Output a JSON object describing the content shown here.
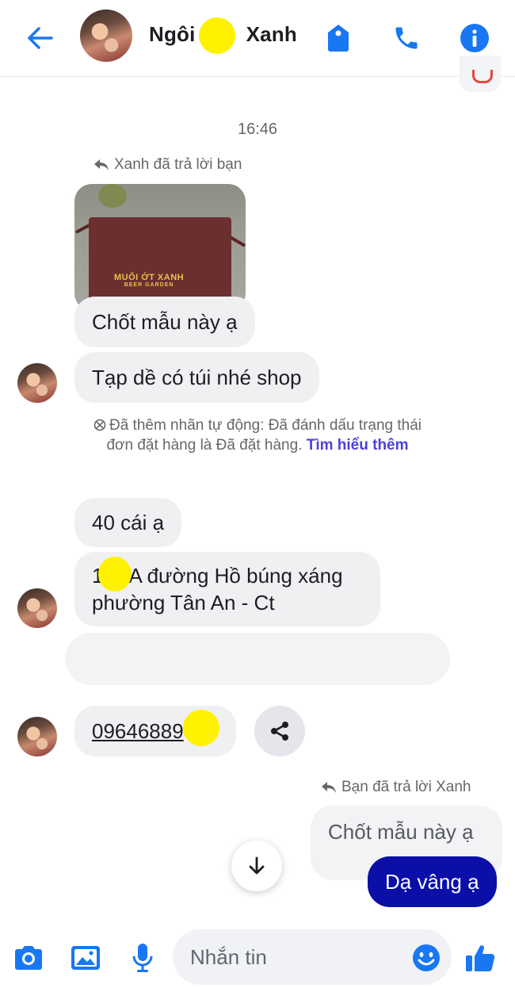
{
  "header": {
    "title_part1": "Ngôi",
    "title_part2": "Xanh",
    "icons": [
      "back-arrow-icon",
      "tag-icon",
      "phone-icon",
      "info-icon"
    ]
  },
  "colors": {
    "accent": "#1877f2",
    "sent_bubble": "#0b0fa8",
    "link": "#4b3fe0",
    "redaction": "#fff200"
  },
  "thread": {
    "timestamp": "16:46",
    "reply_note_in": "Xanh đã trả lời bạn",
    "photo_text_main": "MUỐI ỚT XANH",
    "photo_text_sub": "BEER GARDEN",
    "msg_1": "Chốt mẫu này ạ",
    "msg_2": "Tạp dề có túi nhé shop",
    "system_note": "Đã thêm nhãn tự động: Đã đánh dấu trạng thái đơn đặt hàng là Đã đặt hàng.",
    "system_link": "Tìm hiểu thêm",
    "msg_3": "40 cái ạ",
    "msg_4_line1_prefix": "1",
    "msg_4_line1": "A đường Hồ búng xáng",
    "msg_4_line2": "phường Tân An - Ct",
    "msg_5_phone": "09646889",
    "reply_note_out": "Bạn đã trả lời Xanh",
    "quoted_out": "Chốt mẫu này ạ",
    "msg_out": "Dạ vâng ạ"
  },
  "composer": {
    "placeholder": "Nhắn tin",
    "icons": [
      "camera-icon",
      "image-icon",
      "microphone-icon",
      "emoji-icon",
      "thumbs-up-icon"
    ]
  }
}
